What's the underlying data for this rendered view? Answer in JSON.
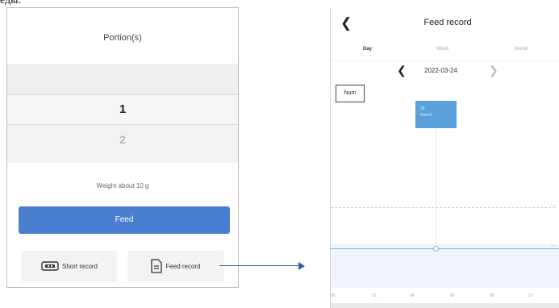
{
  "caption": "еды.",
  "left_screen": {
    "portion_title": "Portion(s)",
    "picker": {
      "selected": "1",
      "next": "2"
    },
    "weight_text": "Weight  about 10 g",
    "feed_button": "Feed",
    "short_record_button": "Short record",
    "feed_record_button": "Feed record"
  },
  "right_screen": {
    "title": "Feed record",
    "tabs": [
      {
        "label": "Day",
        "active": true
      },
      {
        "label": "Week",
        "active": false
      },
      {
        "label": "Month",
        "active": false
      }
    ],
    "date": "2022-03-24",
    "chart_legend": "Num",
    "bar_tooltip": {
      "line1": "06",
      "line2": "Num:0"
    },
    "y_labels": [
      "0.0",
      "0.0"
    ],
    "x_labels": [
      "00",
      "02",
      "04",
      "06",
      "08",
      "10"
    ]
  },
  "colors": {
    "accent_blue": "#4a7fd0",
    "bar_blue": "#5aa0db",
    "arrow": "#2f5fa0"
  }
}
